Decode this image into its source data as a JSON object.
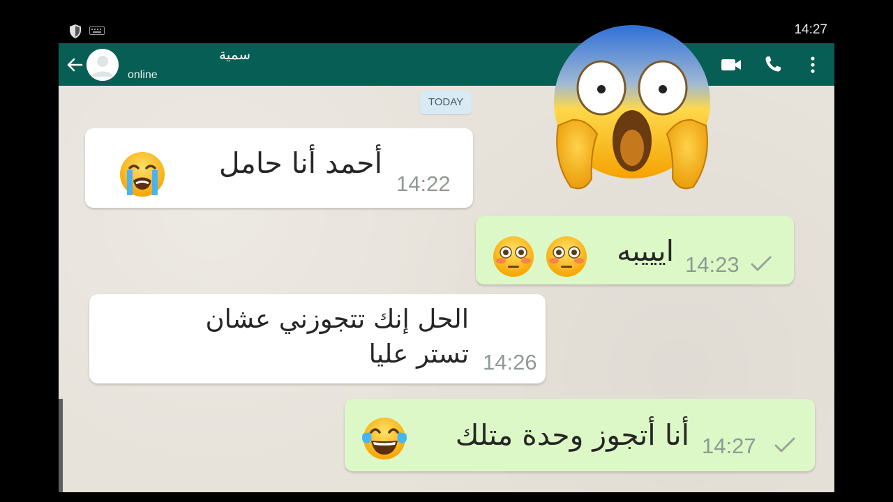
{
  "status_bar": {
    "time": "14:27",
    "icons": [
      "shield-icon",
      "keyboard-icon"
    ]
  },
  "header": {
    "contact_name": "سمية",
    "contact_status": "online",
    "actions": [
      "video-call-icon",
      "phone-icon",
      "more-vert-icon"
    ]
  },
  "chat": {
    "date_label": "TODAY",
    "messages": [
      {
        "direction": "incoming",
        "text": "أحمد أنا حامل",
        "emojis": [
          "loudly-crying-face"
        ],
        "time": "14:22"
      },
      {
        "direction": "outgoing",
        "text": "ايييبه",
        "emojis": [
          "flushed-face",
          "flushed-face"
        ],
        "time": "14:23",
        "status": "sent"
      },
      {
        "direction": "incoming",
        "lines": [
          "الحل إنك تتجوزني عشان",
          "تستر عليا"
        ],
        "time": "14:26"
      },
      {
        "direction": "outgoing",
        "text": "أنا أتجوز وحدة متلك",
        "emojis": [
          "face-with-tears-of-joy"
        ],
        "time": "14:27",
        "status": "sent"
      }
    ]
  },
  "overlay": {
    "emoji": "face-screaming-in-fear"
  },
  "colors": {
    "appbar": "#075e54",
    "incoming_bubble": "#ffffff",
    "outgoing_bubble": "#dcf8c6",
    "chat_background": "#e7e2da"
  }
}
